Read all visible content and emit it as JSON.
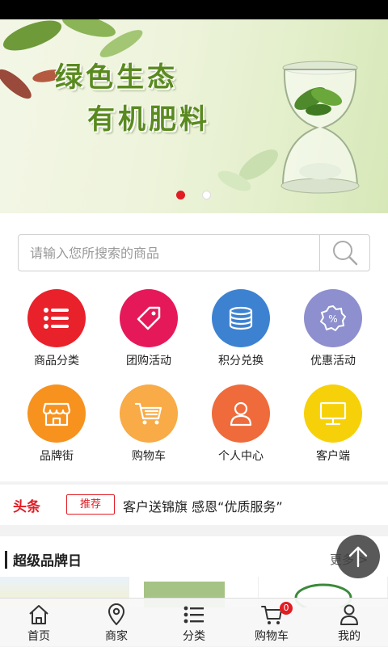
{
  "banner": {
    "line1": "绿色生态",
    "line2": "有机肥料",
    "slide_index": 1,
    "slide_count": 2
  },
  "search": {
    "placeholder": "请输入您所搜索的商品",
    "icon": "search-icon"
  },
  "grid": {
    "items": [
      {
        "label": "商品分类",
        "icon": "list-icon",
        "color": "#e8212b"
      },
      {
        "label": "团购活动",
        "icon": "tag-icon",
        "color": "#e5195a"
      },
      {
        "label": "积分兑换",
        "icon": "coins-icon",
        "color": "#3d82d0"
      },
      {
        "label": "优惠活动",
        "icon": "discount-icon",
        "color": "#8d8fce"
      },
      {
        "label": "品牌街",
        "icon": "store-icon",
        "color": "#f7921e"
      },
      {
        "label": "购物车",
        "icon": "cart-icon",
        "color": "#f8ab46"
      },
      {
        "label": "个人中心",
        "icon": "user-icon",
        "color": "#ef6b3b"
      },
      {
        "label": "客户端",
        "icon": "monitor-icon",
        "color": "#f6d10a"
      }
    ]
  },
  "news": {
    "tag": "头条",
    "badge": "推荐",
    "text": "客户送锦旗 感恩“优质服务”"
  },
  "brand": {
    "title": "超级品牌日",
    "more": "更多 >"
  },
  "tabbar": {
    "items": [
      {
        "label": "首页",
        "icon": "home-icon"
      },
      {
        "label": "商家",
        "icon": "location-pin-icon"
      },
      {
        "label": "分类",
        "icon": "list-icon"
      },
      {
        "label": "购物车",
        "icon": "cart-icon",
        "badge": "0"
      },
      {
        "label": "我的",
        "icon": "user-icon"
      }
    ]
  },
  "colors": {
    "accent": "#e21c23"
  }
}
